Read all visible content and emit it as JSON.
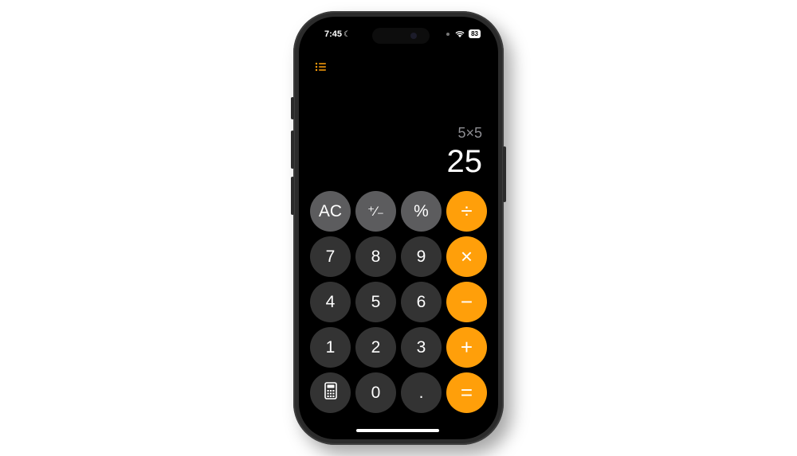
{
  "status": {
    "time": "7:45",
    "battery": "83"
  },
  "display": {
    "expression": "5×5",
    "result": "25"
  },
  "keys": {
    "ac": "AC",
    "sign": "⁺⁄₋",
    "percent": "%",
    "divide": "÷",
    "seven": "7",
    "eight": "8",
    "nine": "9",
    "multiply": "×",
    "four": "4",
    "five": "5",
    "six": "6",
    "minus": "−",
    "one": "1",
    "two": "2",
    "three": "3",
    "plus": "+",
    "zero": "0",
    "decimal": ".",
    "equals": "="
  },
  "colors": {
    "accent": "#ff9f0a",
    "function_key": "#5c5c5e",
    "number_key": "#333333",
    "screen": "#000000"
  },
  "icons": {
    "history": "list-icon",
    "mode": "calculator-icon"
  }
}
